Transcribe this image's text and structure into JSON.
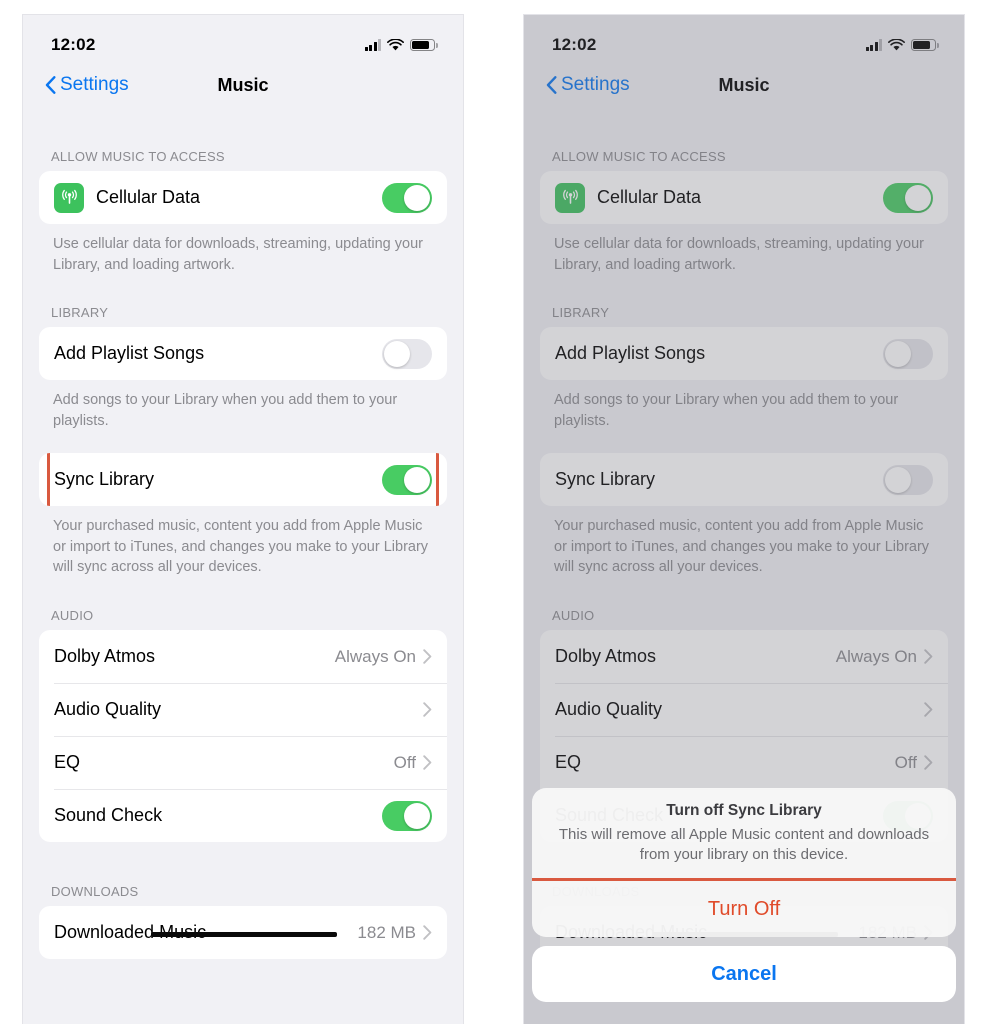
{
  "status_bar": {
    "time": "12:02",
    "icons": [
      "cellular-signal-icon",
      "wifi-icon",
      "battery-icon"
    ]
  },
  "nav": {
    "back_label": "Settings",
    "title": "Music",
    "back_icon": "chevron-left-icon"
  },
  "sections": {
    "access": {
      "header": "ALLOW MUSIC TO ACCESS",
      "rows": [
        {
          "label": "Cellular Data",
          "icon": "cellular-data-icon",
          "toggle": "on"
        }
      ],
      "footnote": "Use cellular data for downloads, streaming, updating your Library, and loading artwork."
    },
    "library": {
      "header": "LIBRARY",
      "add_playlist": {
        "label": "Add Playlist Songs",
        "toggle": "off"
      },
      "add_playlist_footnote": "Add songs to your Library when you add them to your playlists.",
      "sync": {
        "label": "Sync Library",
        "toggle_left": "on",
        "toggle_right": "off"
      },
      "sync_footnote": "Your purchased music, content you add from Apple Music or import to iTunes, and changes you make to your Library will sync across all your devices."
    },
    "audio": {
      "header": "AUDIO",
      "rows": [
        {
          "label": "Dolby Atmos",
          "value": "Always On",
          "accessory": "chevron-right-icon"
        },
        {
          "label": "Audio Quality",
          "value": "",
          "accessory": "chevron-right-icon"
        },
        {
          "label": "EQ",
          "value": "Off",
          "accessory": "chevron-right-icon"
        },
        {
          "label": "Sound Check",
          "value": "",
          "accessory": "toggle-on"
        }
      ]
    },
    "downloads": {
      "header": "DOWNLOADS",
      "rows": [
        {
          "label": "Downloaded Music",
          "value": "182 MB",
          "accessory": "chevron-right-icon",
          "redacted": true
        }
      ]
    }
  },
  "alert": {
    "title": "Turn off Sync Library",
    "message": "This will remove all Apple Music content and downloads from your library on this device.",
    "destructive_label": "Turn Off",
    "cancel_label": "Cancel"
  },
  "colors": {
    "accent_blue": "#0a76f0",
    "toggle_on_green": "#48cc63",
    "toggle_off_gray": "#e6e6eb",
    "destructive_red": "#e04b2a",
    "highlight_border": "#d9593f",
    "icon_green": "#3dc25d"
  }
}
